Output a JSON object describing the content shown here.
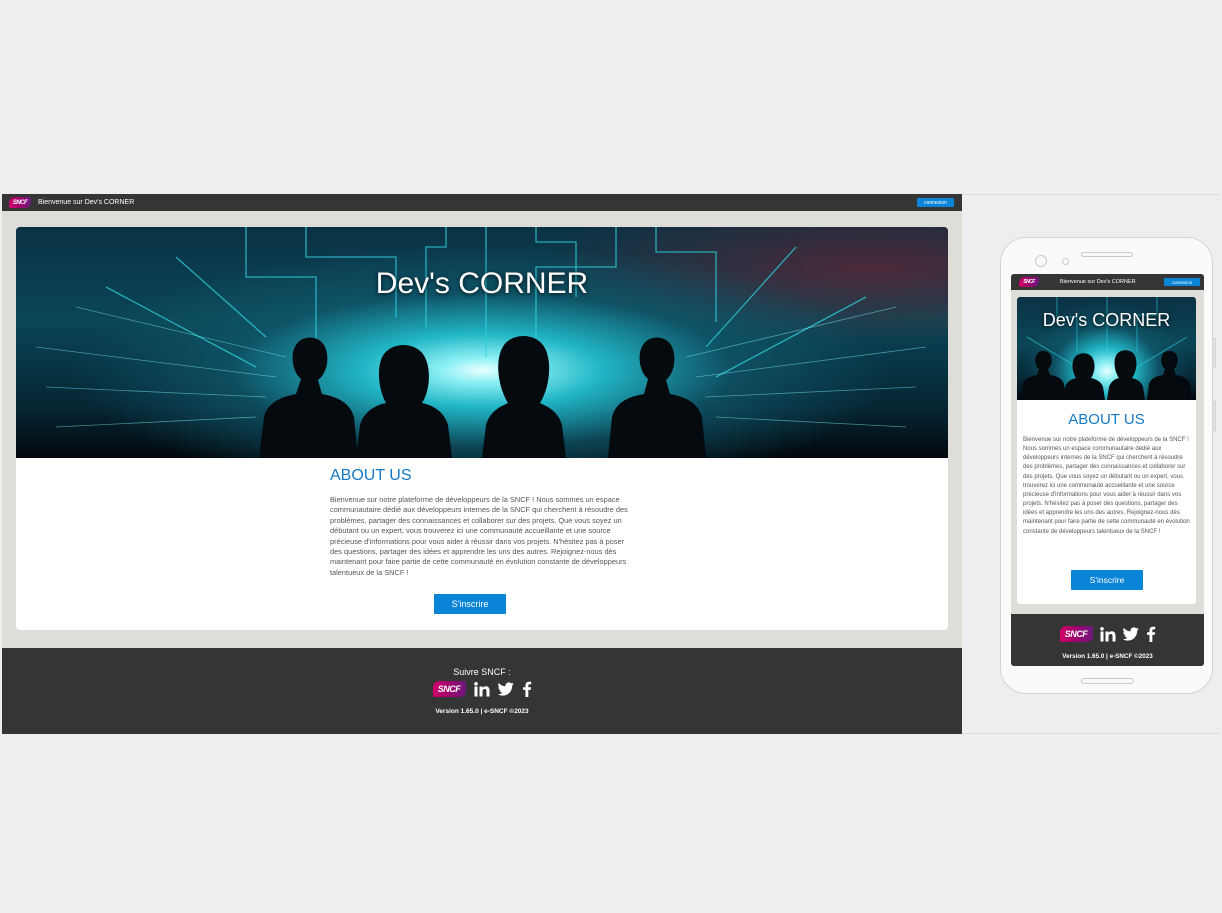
{
  "site": {
    "logo_text": "SNCF",
    "welcome": "Bienvenue sur Dev's CORNER",
    "connexion_label": "connexion",
    "hero_title": "Dev's CORNER",
    "about_title": "ABOUT US",
    "about_text": "Bienvenue sur notre plateforme de développeurs de la SNCF ! Nous sommes un espace communautaire dédié aux développeurs internes de la SNCF qui cherchent à résoudre des problèmes, partager des connaissances et collaborer sur des projets. Que vous soyez un débutant ou un expert, vous trouverez ici une communauté accueillante et une source précieuse d'informations pour vous aider à réussir dans vos projets. N'hésitez pas à poser des questions, partager des idées et apprendre les uns des autres. Rejoignez-nous dès maintenant pour faire partie de cette communauté en évolution constante de développeurs talentueux de la SNCF !",
    "signup_label": "S'inscrire",
    "follow_label": "Suivre SNCF :",
    "version_text": "Version 1.65.0 | e-SNCF ©2023",
    "social_icons": [
      "sncf-logo",
      "linkedin-icon",
      "twitter-icon",
      "facebook-icon"
    ]
  },
  "colors": {
    "topbar": "#353535",
    "accent": "#0a84d6",
    "heading": "#1679c4",
    "page_background": "#dfddd7",
    "footer": "#353535"
  }
}
